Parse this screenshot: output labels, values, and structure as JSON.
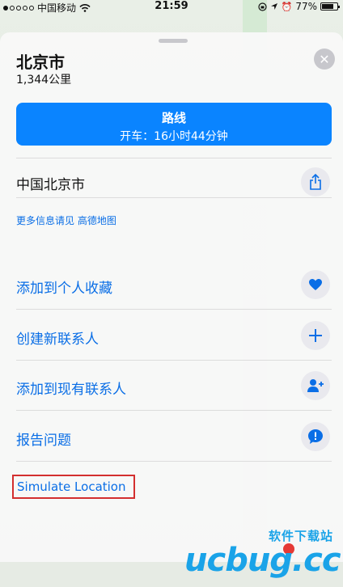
{
  "statusbar": {
    "carrier": "中国移动",
    "time": "21:59",
    "battery": "77%",
    "battery_level": 0.77
  },
  "sheet": {
    "title": "北京市",
    "distance": "1,344公里",
    "close_icon": "close-icon"
  },
  "route": {
    "label": "路线",
    "sub": "开车：16小时44分钟"
  },
  "address": {
    "label": "中国北京市",
    "share_icon": "share-icon"
  },
  "info_link": "更多信息请见 高德地图",
  "actions": [
    {
      "label": "添加到个人收藏",
      "icon": "heart-icon"
    },
    {
      "label": "创建新联系人",
      "icon": "plus-icon"
    },
    {
      "label": "添加到现有联系人",
      "icon": "add-contact-icon"
    },
    {
      "label": "报告问题",
      "icon": "report-icon"
    }
  ],
  "simulate_label": "Simulate Location",
  "watermark": {
    "top": "软件下载站",
    "logo": "ucbug.cc"
  },
  "colors": {
    "accent": "#0a84ff",
    "link": "#0a6ee6",
    "highlight_border": "#d32f2f"
  }
}
